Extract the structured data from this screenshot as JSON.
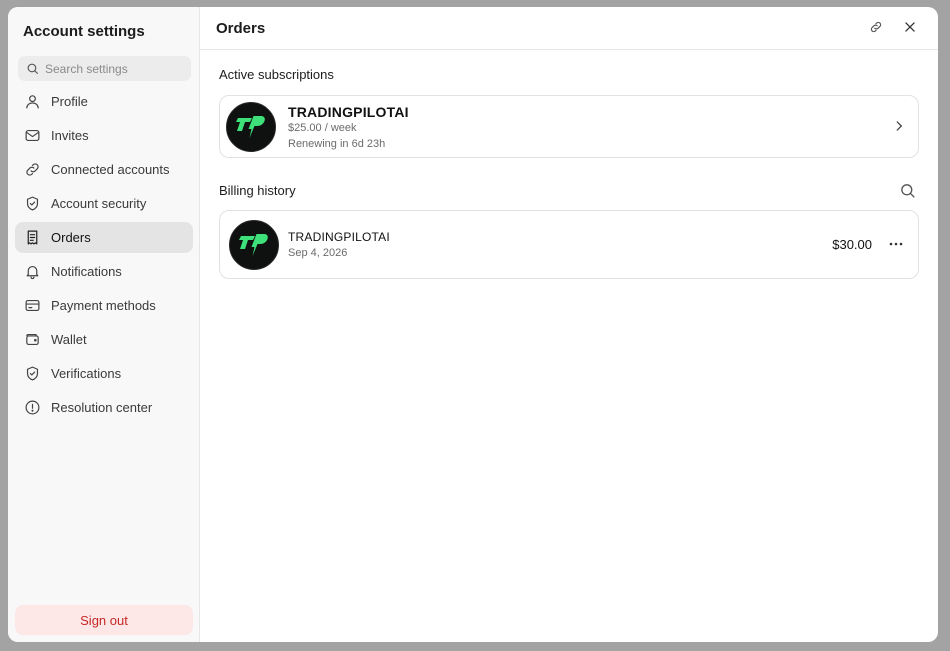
{
  "sidebar": {
    "title": "Account settings",
    "search_placeholder": "Search settings",
    "items": [
      {
        "label": "Profile",
        "icon": "user-icon",
        "active": false
      },
      {
        "label": "Invites",
        "icon": "mail-icon",
        "active": false
      },
      {
        "label": "Connected accounts",
        "icon": "link-icon",
        "active": false
      },
      {
        "label": "Account security",
        "icon": "shield-icon",
        "active": false
      },
      {
        "label": "Orders",
        "icon": "receipt-icon",
        "active": true
      },
      {
        "label": "Notifications",
        "icon": "bell-icon",
        "active": false
      },
      {
        "label": "Payment methods",
        "icon": "credit-card-icon",
        "active": false
      },
      {
        "label": "Wallet",
        "icon": "wallet-icon",
        "active": false
      },
      {
        "label": "Verifications",
        "icon": "shield-check-icon",
        "active": false
      },
      {
        "label": "Resolution center",
        "icon": "alert-circle-icon",
        "active": false
      }
    ],
    "sign_out": "Sign out"
  },
  "header": {
    "title": "Orders"
  },
  "active_subscriptions": {
    "label": "Active subscriptions",
    "items": [
      {
        "name": "TRADINGPILOTAI",
        "price": "$25.00 / week",
        "renewal": "Renewing in 6d 23h"
      }
    ]
  },
  "billing_history": {
    "label": "Billing history",
    "items": [
      {
        "name": "TRADINGPILOTAI",
        "date": "Sep 4, 2026",
        "amount": "$30.00"
      }
    ]
  },
  "colors": {
    "accent_green": "#3ee07a",
    "sign_out_bg": "#fde7e7",
    "sign_out_text": "#c62828",
    "active_item_bg": "#e4e4e4"
  }
}
